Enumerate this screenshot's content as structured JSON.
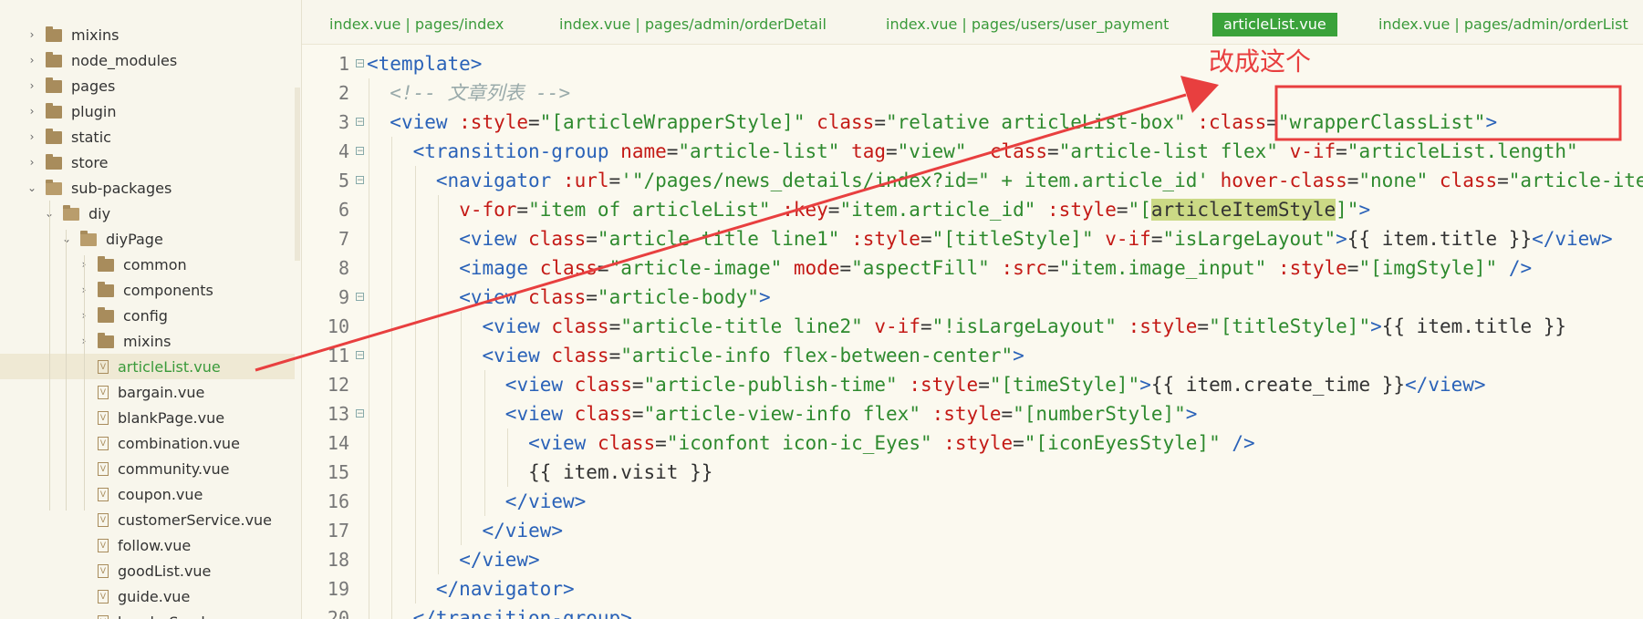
{
  "sidebar": {
    "items": [
      {
        "label": "mixins",
        "type": "folder",
        "expanded": false,
        "depth": 0
      },
      {
        "label": "node_modules",
        "type": "folder",
        "expanded": false,
        "depth": 0
      },
      {
        "label": "pages",
        "type": "folder",
        "expanded": false,
        "depth": 0
      },
      {
        "label": "plugin",
        "type": "folder",
        "expanded": false,
        "depth": 0
      },
      {
        "label": "static",
        "type": "folder",
        "expanded": false,
        "depth": 0
      },
      {
        "label": "store",
        "type": "folder",
        "expanded": false,
        "depth": 0
      },
      {
        "label": "sub-packages",
        "type": "folder",
        "expanded": true,
        "depth": 0
      },
      {
        "label": "diy",
        "type": "folder",
        "expanded": true,
        "depth": 1
      },
      {
        "label": "diyPage",
        "type": "folder",
        "expanded": true,
        "depth": 2
      },
      {
        "label": "common",
        "type": "folder",
        "expanded": false,
        "depth": 3
      },
      {
        "label": "components",
        "type": "folder",
        "expanded": false,
        "depth": 3
      },
      {
        "label": "config",
        "type": "folder",
        "expanded": false,
        "depth": 3
      },
      {
        "label": "mixins",
        "type": "folder",
        "expanded": false,
        "depth": 3
      },
      {
        "label": "articleList.vue",
        "type": "vue",
        "active": true,
        "depth": 3
      },
      {
        "label": "bargain.vue",
        "type": "vue",
        "depth": 3
      },
      {
        "label": "blankPage.vue",
        "type": "vue",
        "depth": 3
      },
      {
        "label": "combination.vue",
        "type": "vue",
        "depth": 3
      },
      {
        "label": "community.vue",
        "type": "vue",
        "depth": 3
      },
      {
        "label": "coupon.vue",
        "type": "vue",
        "depth": 3
      },
      {
        "label": "customerService.vue",
        "type": "vue",
        "depth": 3
      },
      {
        "label": "follow.vue",
        "type": "vue",
        "depth": 3
      },
      {
        "label": "goodList.vue",
        "type": "vue",
        "depth": 3
      },
      {
        "label": "guide.vue",
        "type": "vue",
        "depth": 3
      },
      {
        "label": "headerSerch.vue",
        "type": "vue",
        "depth": 3
      }
    ]
  },
  "tabs": [
    {
      "label": "index.vue | pages/index",
      "active": false
    },
    {
      "label": "index.vue | pages/admin/orderDetail",
      "active": false
    },
    {
      "label": "index.vue | pages/users/user_payment",
      "active": false
    },
    {
      "label": "articleList.vue",
      "active": true
    },
    {
      "label": "index.vue | pages/admin/orderList",
      "active": false
    }
  ],
  "editor": {
    "lines": [
      {
        "num": "1",
        "fold": true,
        "indent": 0,
        "tokens": [
          [
            "tg",
            "<template>"
          ]
        ]
      },
      {
        "num": "2",
        "fold": false,
        "indent": 1,
        "tokens": [
          [
            "cm",
            "<!-- 文章列表 -->"
          ]
        ]
      },
      {
        "num": "3",
        "fold": true,
        "indent": 1,
        "tokens": [
          [
            "tg",
            "<view "
          ],
          [
            "at",
            ":style"
          ],
          [
            "tx",
            "="
          ],
          [
            "sv",
            "\"[articleWrapperStyle]\" "
          ],
          [
            "at",
            "class"
          ],
          [
            "tx",
            "="
          ],
          [
            "sv",
            "\"relative articleList-box\" "
          ],
          [
            "at",
            ":class"
          ],
          [
            "tx",
            "="
          ],
          [
            "sv",
            "\"wrapperClassList\""
          ],
          [
            "tg",
            ">"
          ]
        ]
      },
      {
        "num": "4",
        "fold": true,
        "indent": 2,
        "tokens": [
          [
            "tg",
            "<transition-group "
          ],
          [
            "at",
            "name"
          ],
          [
            "tx",
            "="
          ],
          [
            "sv",
            "\"article-list\" "
          ],
          [
            "at",
            "tag"
          ],
          [
            "tx",
            "="
          ],
          [
            "sv",
            "\"view\"  "
          ],
          [
            "at",
            "class"
          ],
          [
            "tx",
            "="
          ],
          [
            "sv",
            "\"article-list flex\" "
          ],
          [
            "at",
            "v-if"
          ],
          [
            "tx",
            "="
          ],
          [
            "sv",
            "\"articleList.length\""
          ]
        ]
      },
      {
        "num": "5",
        "fold": true,
        "indent": 3,
        "tokens": [
          [
            "tg",
            "<navigator "
          ],
          [
            "at",
            ":url"
          ],
          [
            "tx",
            "="
          ],
          [
            "sv",
            "'\"/pages/news_details/index?id=\" + item.article_id' "
          ],
          [
            "at",
            "hover-class"
          ],
          [
            "tx",
            "="
          ],
          [
            "sv",
            "\"none\" "
          ],
          [
            "at",
            "class"
          ],
          [
            "tx",
            "="
          ],
          [
            "sv",
            "\"article-item\""
          ]
        ]
      },
      {
        "num": "6",
        "fold": false,
        "indent": 4,
        "tokens": [
          [
            "at",
            "v-for"
          ],
          [
            "tx",
            "="
          ],
          [
            "sv",
            "\"item of articleList\" "
          ],
          [
            "at",
            ":key"
          ],
          [
            "tx",
            "="
          ],
          [
            "sv",
            "\"item.article_id\" "
          ],
          [
            "at",
            ":style"
          ],
          [
            "tx",
            "="
          ],
          [
            "sv",
            "\"["
          ],
          [
            "hl",
            "articleItemStyle"
          ],
          [
            "sv",
            "]\""
          ],
          [
            "tg",
            ">"
          ]
        ]
      },
      {
        "num": "7",
        "fold": false,
        "indent": 4,
        "tokens": [
          [
            "tg",
            "<view "
          ],
          [
            "at",
            "class"
          ],
          [
            "tx",
            "="
          ],
          [
            "sv",
            "\"article-title line1\" "
          ],
          [
            "at",
            ":style"
          ],
          [
            "tx",
            "="
          ],
          [
            "sv",
            "\"[titleStyle]\" "
          ],
          [
            "at",
            "v-if"
          ],
          [
            "tx",
            "="
          ],
          [
            "sv",
            "\"isLargeLayout\""
          ],
          [
            "tg",
            ">"
          ],
          [
            "tx",
            "{{ item.title }}"
          ],
          [
            "tg",
            "</view>"
          ]
        ]
      },
      {
        "num": "8",
        "fold": false,
        "indent": 4,
        "tokens": [
          [
            "tg",
            "<image "
          ],
          [
            "at",
            "class"
          ],
          [
            "tx",
            "="
          ],
          [
            "sv",
            "\"article-image\" "
          ],
          [
            "at",
            "mode"
          ],
          [
            "tx",
            "="
          ],
          [
            "sv",
            "\"aspectFill\" "
          ],
          [
            "at",
            ":src"
          ],
          [
            "tx",
            "="
          ],
          [
            "sv",
            "\"item.image_input\" "
          ],
          [
            "at",
            ":style"
          ],
          [
            "tx",
            "="
          ],
          [
            "sv",
            "\"[imgStyle]\" "
          ],
          [
            "tg",
            "/>"
          ]
        ]
      },
      {
        "num": "9",
        "fold": true,
        "indent": 4,
        "tokens": [
          [
            "tg",
            "<view "
          ],
          [
            "at",
            "class"
          ],
          [
            "tx",
            "="
          ],
          [
            "sv",
            "\"article-body\""
          ],
          [
            "tg",
            ">"
          ]
        ]
      },
      {
        "num": "10",
        "fold": false,
        "indent": 5,
        "tokens": [
          [
            "tg",
            "<view "
          ],
          [
            "at",
            "class"
          ],
          [
            "tx",
            "="
          ],
          [
            "sv",
            "\"article-title line2\" "
          ],
          [
            "at",
            "v-if"
          ],
          [
            "tx",
            "="
          ],
          [
            "sv",
            "\"!isLargeLayout\" "
          ],
          [
            "at",
            ":style"
          ],
          [
            "tx",
            "="
          ],
          [
            "sv",
            "\"[titleStyle]\""
          ],
          [
            "tg",
            ">"
          ],
          [
            "tx",
            "{{ item.title }}"
          ]
        ]
      },
      {
        "num": "11",
        "fold": true,
        "indent": 5,
        "tokens": [
          [
            "tg",
            "<view "
          ],
          [
            "at",
            "class"
          ],
          [
            "tx",
            "="
          ],
          [
            "sv",
            "\"article-info flex-between-center\""
          ],
          [
            "tg",
            ">"
          ]
        ]
      },
      {
        "num": "12",
        "fold": false,
        "indent": 6,
        "tokens": [
          [
            "tg",
            "<view "
          ],
          [
            "at",
            "class"
          ],
          [
            "tx",
            "="
          ],
          [
            "sv",
            "\"article-publish-time\" "
          ],
          [
            "at",
            ":style"
          ],
          [
            "tx",
            "="
          ],
          [
            "sv",
            "\"[timeStyle]\""
          ],
          [
            "tg",
            ">"
          ],
          [
            "tx",
            "{{ item.create_time }}"
          ],
          [
            "tg",
            "</view>"
          ]
        ]
      },
      {
        "num": "13",
        "fold": true,
        "indent": 6,
        "tokens": [
          [
            "tg",
            "<view "
          ],
          [
            "at",
            "class"
          ],
          [
            "tx",
            "="
          ],
          [
            "sv",
            "\"article-view-info flex\" "
          ],
          [
            "at",
            ":style"
          ],
          [
            "tx",
            "="
          ],
          [
            "sv",
            "\"[numberStyle]\""
          ],
          [
            "tg",
            ">"
          ]
        ]
      },
      {
        "num": "14",
        "fold": false,
        "indent": 7,
        "tokens": [
          [
            "tg",
            "<view "
          ],
          [
            "at",
            "class"
          ],
          [
            "tx",
            "="
          ],
          [
            "sv",
            "\"iconfont icon-ic_Eyes\" "
          ],
          [
            "at",
            ":style"
          ],
          [
            "tx",
            "="
          ],
          [
            "sv",
            "\"[iconEyesStyle]\" "
          ],
          [
            "tg",
            "/>"
          ]
        ]
      },
      {
        "num": "15",
        "fold": false,
        "indent": 7,
        "tokens": [
          [
            "tx",
            "{{ item.visit }}"
          ]
        ]
      },
      {
        "num": "16",
        "fold": false,
        "indent": 6,
        "tokens": [
          [
            "tg",
            "</view>"
          ]
        ]
      },
      {
        "num": "17",
        "fold": false,
        "indent": 5,
        "tokens": [
          [
            "tg",
            "</view>"
          ]
        ]
      },
      {
        "num": "18",
        "fold": false,
        "indent": 4,
        "tokens": [
          [
            "tg",
            "</view>"
          ]
        ]
      },
      {
        "num": "19",
        "fold": false,
        "indent": 3,
        "tokens": [
          [
            "tg",
            "</navigator>"
          ]
        ]
      },
      {
        "num": "20",
        "fold": false,
        "indent": 2,
        "tokens": [
          [
            "tg",
            "</transition-group>"
          ]
        ]
      }
    ]
  },
  "annotation": {
    "text": "改成这个",
    "color": "#e83f3f"
  },
  "colors": {
    "tag": "#2a62b8",
    "attr": "#c41a16",
    "string": "#2e8a2e",
    "comment": "#9aa",
    "highlight": "#cbd985",
    "active_tab": "#3aa23a"
  }
}
